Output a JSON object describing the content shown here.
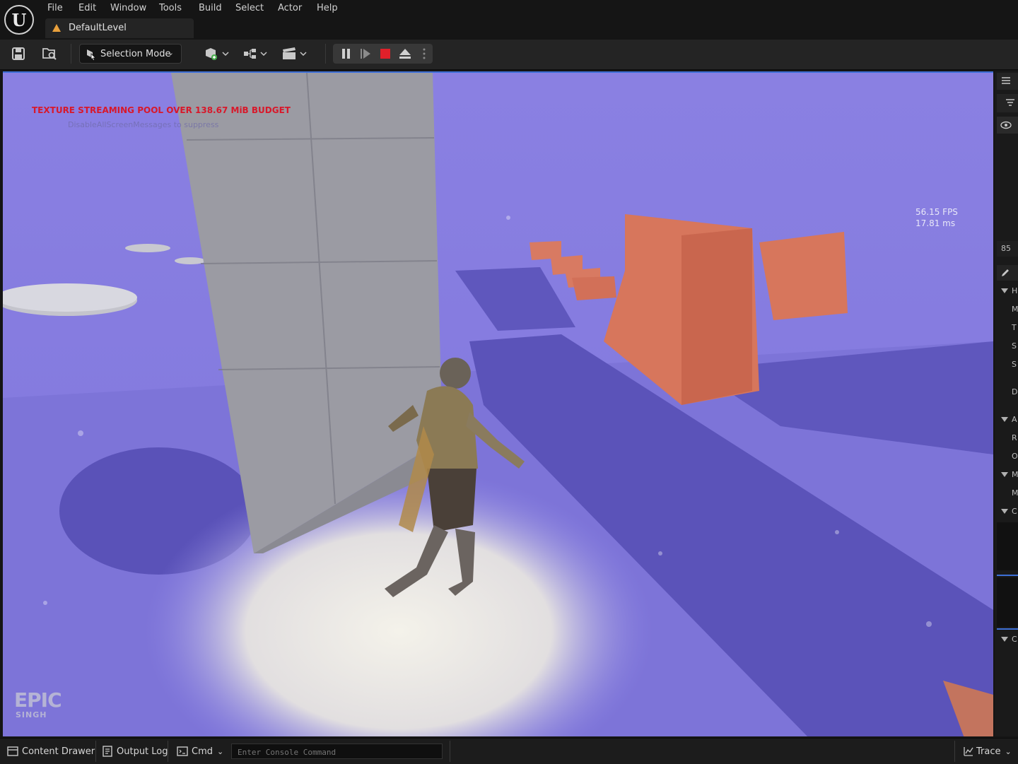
{
  "menu": {
    "items": [
      "File",
      "Edit",
      "Window",
      "Tools",
      "Build",
      "Select",
      "Actor",
      "Help"
    ]
  },
  "level_tab": {
    "label": "DefaultLevel"
  },
  "toolbar": {
    "selection_mode_label": "Selection Mode",
    "icons": [
      "save-icon",
      "browse-icon",
      "add-actor-icon",
      "blueprint-icon",
      "cinematics-icon"
    ],
    "play_controls": [
      "pause-icon",
      "step-icon",
      "stop-icon",
      "eject-icon",
      "more-icon"
    ]
  },
  "viewport": {
    "warning": "TEXTURE STREAMING POOL OVER 138.67 MiB BUDGET",
    "warning_sub": "DisableAllScreenMessages to suppress",
    "fps": "56.15 FPS",
    "frame_time": "17.81 ms",
    "watermark_big": "EPIC",
    "watermark_small": "SINGH",
    "colors": {
      "floor": "#8e86e6",
      "pillar": "#9c9ca4",
      "blocks": "#d7765c",
      "shadow": "#5a52b8"
    }
  },
  "details_panel": {
    "value_85": "85",
    "rows": [
      "H",
      "M",
      "T",
      "S",
      "S",
      "D",
      "A",
      "R",
      "O",
      "M",
      "M",
      "C",
      "C"
    ]
  },
  "bottombar": {
    "content_drawer": "Content Drawer",
    "output_log": "Output Log",
    "cmd": "Cmd",
    "console_placeholder": "Enter Console Command",
    "trace": "Trace"
  }
}
